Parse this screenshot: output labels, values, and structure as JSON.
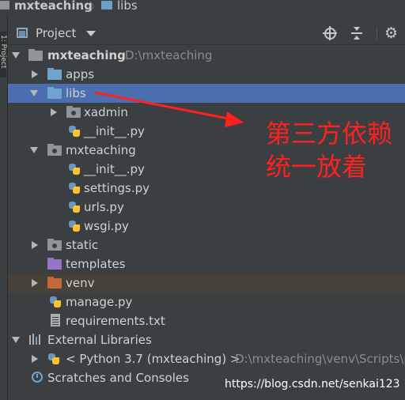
{
  "breadcrumb": {
    "project": "mxteaching",
    "current": "libs"
  },
  "side_tab": "1: Project",
  "header": {
    "title": "Project"
  },
  "tree": {
    "root": {
      "name": "mxteaching",
      "path": "D:\\mxteaching"
    },
    "apps": "apps",
    "libs": "libs",
    "xadmin": "xadmin",
    "libs_init": "__init__.py",
    "mxteaching_pkg": "mxteaching",
    "pkg_init": "__init__.py",
    "settings": "settings.py",
    "urls": "urls.py",
    "wsgi": "wsgi.py",
    "static": "static",
    "templates": "templates",
    "venv": "venv",
    "manage": "manage.py",
    "requirements": "requirements.txt",
    "external_libraries": "External Libraries",
    "python_sdk": "< Python 3.7 (mxteaching) >",
    "python_path": "D:\\mxteaching\\venv\\Scripts\\p",
    "scratches": "Scratches and Consoles"
  },
  "annotation": {
    "line1": "第三方依赖",
    "line2": "统一放着"
  },
  "watermark": "https://blog.csdn.net/senkai123",
  "colors": {
    "selection": "#4b6eaf",
    "annotation": "#ff2020",
    "background": "#3c3f41"
  }
}
